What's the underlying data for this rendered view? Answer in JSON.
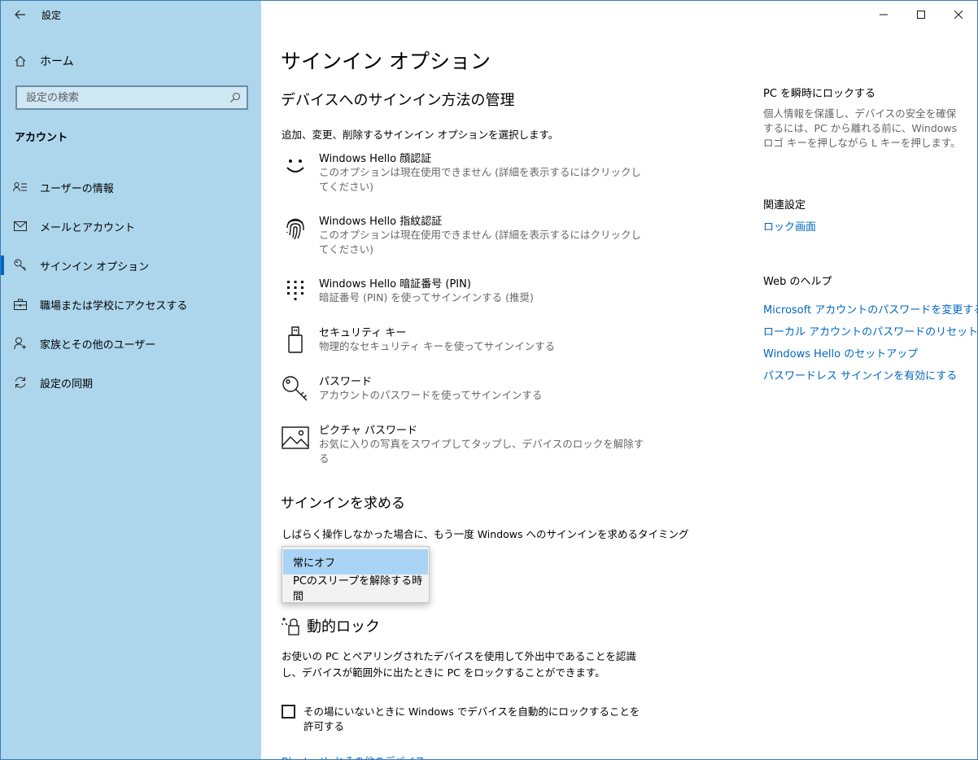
{
  "window": {
    "title": "設定",
    "controls": [
      "minimize",
      "maximize",
      "close"
    ]
  },
  "sidebar": {
    "home_label": "ホーム",
    "search_placeholder": "設定の検索",
    "section_label": "アカウント",
    "items": [
      {
        "label": "ユーザーの情報",
        "icon": "user-info-icon"
      },
      {
        "label": "メールとアカウント",
        "icon": "mail-icon"
      },
      {
        "label": "サインイン オプション",
        "icon": "key-icon",
        "selected": true
      },
      {
        "label": "職場または学校にアクセスする",
        "icon": "briefcase-icon"
      },
      {
        "label": "家族とその他のユーザー",
        "icon": "add-user-icon"
      },
      {
        "label": "設定の同期",
        "icon": "sync-icon"
      }
    ]
  },
  "main": {
    "page_title": "サインイン オプション",
    "manage_heading": "デバイスへのサインイン方法の管理",
    "manage_desc": "追加、変更、削除するサインイン オプションを選択します。",
    "options": [
      {
        "title": "Windows Hello 顔認証",
        "subtitle": "このオプションは現在使用できません (詳細を表示するにはクリックしてください)",
        "icon": "face-icon"
      },
      {
        "title": "Windows Hello 指紋認証",
        "subtitle": "このオプションは現在使用できません (詳細を表示するにはクリックしてください)",
        "icon": "fingerprint-icon"
      },
      {
        "title": "Windows Hello 暗証番号 (PIN)",
        "subtitle": "暗証番号 (PIN) を使ってサインインする (推奨)",
        "icon": "pin-keypad-icon"
      },
      {
        "title": "セキュリティ キー",
        "subtitle": "物理的なセキュリティ キーを使ってサインインする",
        "icon": "usb-key-icon"
      },
      {
        "title": "パスワード",
        "subtitle": "アカウントのパスワードを使ってサインインする",
        "icon": "password-key-icon"
      },
      {
        "title": "ピクチャ パスワード",
        "subtitle": "お気に入りの写真をスワイプしてタップし、デバイスのロックを解除する",
        "icon": "picture-icon"
      }
    ],
    "require_heading": "サインインを求める",
    "require_desc": "しばらく操作しなかった場合に、もう一度 Windows へのサインインを求めるタイミング",
    "require_options": [
      "常にオフ",
      "PCのスリープを解除する時間"
    ],
    "require_selected": "常にオフ",
    "dynamic_heading": "動的ロック",
    "dynamic_desc": "お使いの PC とペアリングされたデバイスを使用して外出中であることを認識し、デバイスが範囲外に出たときに PC をロックすることができます。",
    "dynamic_checkbox_label": "その場にいないときに Windows でデバイスを自動的にロックすることを許可する",
    "dynamic_checkbox_checked": false,
    "bluetooth_link": "Bluetooth とその他のデバイス"
  },
  "right_panel": {
    "lock_heading": "PC を瞬時にロックする",
    "lock_desc": "個人情報を保護し、デバイスの安全を確保するには、PC から離れる前に、Windows ロゴ キーを押しながら L キーを押します。",
    "related_heading": "関連設定",
    "related_links": [
      "ロック画面"
    ],
    "help_heading": "Web のヘルプ",
    "help_links": [
      "Microsoft アカウントのパスワードを変更する",
      "ローカル アカウントのパスワードのリセット",
      "Windows Hello のセットアップ",
      "パスワードレス サインインを有効にする"
    ]
  },
  "colors": {
    "sidebar_bg": "#add6ec",
    "accent": "#0067c0",
    "dropdown_selected": "#a9d4f5"
  }
}
